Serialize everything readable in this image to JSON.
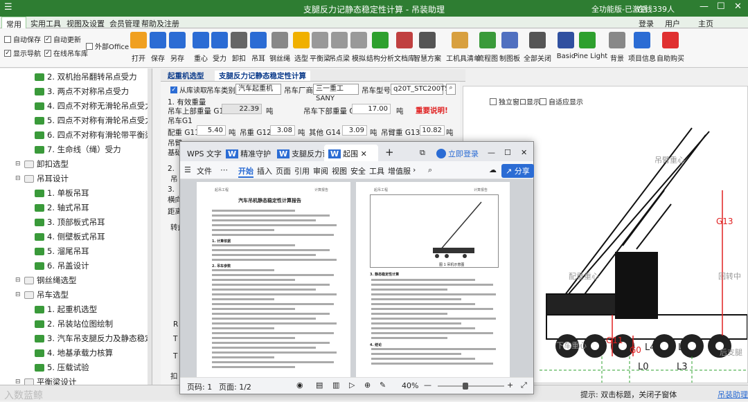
{
  "titlebar": {
    "title": "支腿反力记静态稳定性计算 - 吊装助理",
    "status": "全功能版-已激活",
    "online": "在线339人",
    "min": "—",
    "max": "☐",
    "close": "✕"
  },
  "menu": {
    "tabs": [
      "常用",
      "实用工具",
      "视图及设置",
      "会员管理",
      "帮助及注册"
    ],
    "right": [
      "登录",
      "用户",
      "主页"
    ]
  },
  "ribbon": {
    "checks": [
      {
        "label": "自动保存",
        "checked": false
      },
      {
        "label": "自动更新",
        "checked": true
      },
      {
        "label": "显示导航",
        "checked": true
      },
      {
        "label": "在线吊车库",
        "checked": true
      },
      {
        "label": "外部Office",
        "checked": false
      }
    ],
    "buttons": [
      "打开",
      "保存",
      "另存",
      "重心",
      "受力",
      "卸扣",
      "吊耳",
      "钢丝绳",
      "选型",
      "平衡梁",
      "吊点梁",
      "模拟",
      "结构分析",
      "文档库",
      "智慧方案",
      "工机具清单",
      "流程图",
      "制图板",
      "全部关闭",
      "Basic",
      "Pine Light",
      "背景",
      "项目信息",
      "自助购买"
    ]
  },
  "tree": {
    "items": [
      {
        "label": "2. 双机抬吊翻转吊点受力",
        "level": 3
      },
      {
        "label": "3. 两点不对称吊点受力",
        "level": 3
      },
      {
        "label": "4. 四点不对称无滑轮吊点受力",
        "level": 3
      },
      {
        "label": "5. 四点不对称有滑轮吊点受力",
        "level": 3
      },
      {
        "label": "6. 四点不对称有滑轮带平衡梁吊",
        "level": 3
      },
      {
        "label": "7. 生命线（绳）受力",
        "level": 3
      },
      {
        "label": "卸扣选型",
        "level": 1
      },
      {
        "label": "吊耳设计",
        "level": 1
      },
      {
        "label": "1. 单板吊耳",
        "level": 3
      },
      {
        "label": "2. 轴式吊耳",
        "level": 3
      },
      {
        "label": "3. 顶部板式吊耳",
        "level": 3
      },
      {
        "label": "4. 侧壁板式吊耳",
        "level": 3
      },
      {
        "label": "5. 溜尾吊耳",
        "level": 3
      },
      {
        "label": "6. 吊盖设计",
        "level": 3
      },
      {
        "label": "钢丝绳选型",
        "level": 1
      },
      {
        "label": "吊车选型",
        "level": 1
      },
      {
        "label": "1. 起重机选型",
        "level": 3
      },
      {
        "label": "2. 吊装站位图绘制",
        "level": 3
      },
      {
        "label": "3. 汽车吊支腿反力及静态稳定",
        "level": 3
      },
      {
        "label": "4. 地基承载力核算",
        "level": 3
      },
      {
        "label": "5. 压载试验",
        "level": 3
      },
      {
        "label": "平衡梁设计",
        "level": 1
      }
    ]
  },
  "doctabs": [
    "起重机选型",
    "支腿反力记静态稳定性计算"
  ],
  "form": {
    "from_lib": "从库读取",
    "crane_type_label": "吊车类别",
    "crane_type": "汽车起重机",
    "maker_label": "吊车厂商",
    "maker": "三一重工SANY",
    "model_label": "吊车型号",
    "model": "q20T_STC200T5",
    "s1": "1. 有效重量",
    "upper_label": "吊车上部重量 G1",
    "upper_val": "22.39",
    "unit_t": "吨",
    "lower_label": "吊车下部重量 G0",
    "lower_val": "17.00",
    "note": "重要说明!",
    "g1_label": "吊车G1",
    "cw_label": "配重 G11",
    "cw": "5.40",
    "hook_label": "吊重 G12",
    "hook": "3.08",
    "other_label": "其他 G14",
    "other": "3.09",
    "boom_label": "吊臂重 G13",
    "boom": "10.82",
    "p1": "吊臂",
    "p2": "基础",
    "s2": "2.",
    "s3": "3.",
    "dist": "距离",
    "turn": "转盘",
    "horiz": "横向",
    "r": "吊",
    "f1": "R",
    "f2": "T",
    "f3": "T",
    "bot": "扣"
  },
  "drawing": {
    "cb1": "独立窗口显示",
    "cb2": "自适应显示",
    "labels": [
      "吊臂重心",
      "G13",
      "配重重心",
      "回转中",
      "G11",
      "G0",
      "下车重心",
      "后支腿",
      "L4",
      "Lz",
      "L0",
      "L3"
    ]
  },
  "wps": {
    "tabs": [
      "WPS 文字",
      "精准守护",
      "支腿反力计",
      "起围"
    ],
    "login": "立即登录",
    "menus": [
      "文件",
      "开始",
      "插入",
      "页面",
      "引用",
      "审阅",
      "视图",
      "安全",
      "工具",
      "增值服"
    ],
    "share": "分享",
    "page1": {
      "header_l": "起吊工程",
      "header_r": "计算报告",
      "title": "汽车吊机静态稳定性计算报告",
      "s1": "1. 计算依据",
      "s2": "2. 吊车参数"
    },
    "page2": {
      "header_l": "起吊工程",
      "header_r": "计算报告",
      "caption": "图 1 吊机示意图",
      "s3": "3. 静态稳定性计算",
      "s4": "4. 结论"
    },
    "status": {
      "page": "页码: 1",
      "pages": "页面: 1/2",
      "zoom": "40%"
    }
  },
  "status": {
    "hint": "提示: 双击标题，关闭子窗体",
    "link": "吊装助理",
    "watermark": "入数蓝鲸"
  },
  "colors": {
    "title": "#2e7d32",
    "accent": "#2b6cd4",
    "red": "#e02020"
  }
}
